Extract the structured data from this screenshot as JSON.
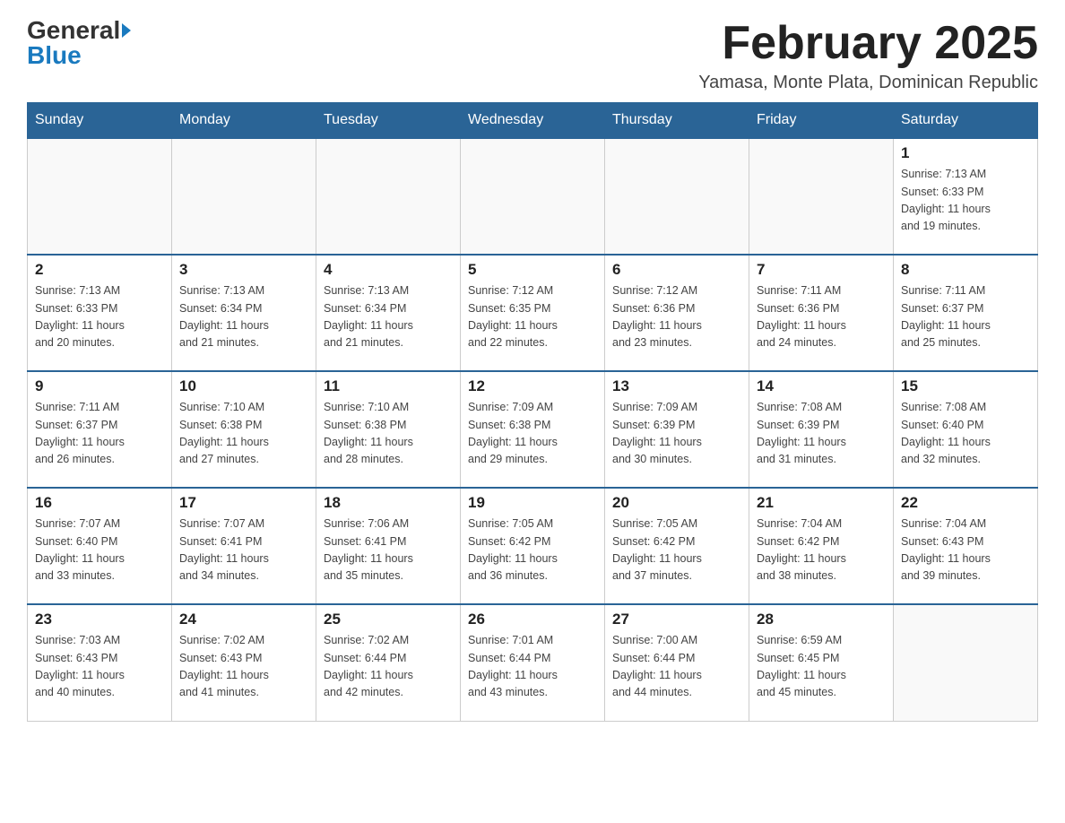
{
  "header": {
    "logo_main": "General",
    "logo_sub": "Blue",
    "month_year": "February 2025",
    "location": "Yamasa, Monte Plata, Dominican Republic"
  },
  "days_of_week": [
    "Sunday",
    "Monday",
    "Tuesday",
    "Wednesday",
    "Thursday",
    "Friday",
    "Saturday"
  ],
  "weeks": [
    [
      {
        "day": "",
        "info": ""
      },
      {
        "day": "",
        "info": ""
      },
      {
        "day": "",
        "info": ""
      },
      {
        "day": "",
        "info": ""
      },
      {
        "day": "",
        "info": ""
      },
      {
        "day": "",
        "info": ""
      },
      {
        "day": "1",
        "info": "Sunrise: 7:13 AM\nSunset: 6:33 PM\nDaylight: 11 hours\nand 19 minutes."
      }
    ],
    [
      {
        "day": "2",
        "info": "Sunrise: 7:13 AM\nSunset: 6:33 PM\nDaylight: 11 hours\nand 20 minutes."
      },
      {
        "day": "3",
        "info": "Sunrise: 7:13 AM\nSunset: 6:34 PM\nDaylight: 11 hours\nand 21 minutes."
      },
      {
        "day": "4",
        "info": "Sunrise: 7:13 AM\nSunset: 6:34 PM\nDaylight: 11 hours\nand 21 minutes."
      },
      {
        "day": "5",
        "info": "Sunrise: 7:12 AM\nSunset: 6:35 PM\nDaylight: 11 hours\nand 22 minutes."
      },
      {
        "day": "6",
        "info": "Sunrise: 7:12 AM\nSunset: 6:36 PM\nDaylight: 11 hours\nand 23 minutes."
      },
      {
        "day": "7",
        "info": "Sunrise: 7:11 AM\nSunset: 6:36 PM\nDaylight: 11 hours\nand 24 minutes."
      },
      {
        "day": "8",
        "info": "Sunrise: 7:11 AM\nSunset: 6:37 PM\nDaylight: 11 hours\nand 25 minutes."
      }
    ],
    [
      {
        "day": "9",
        "info": "Sunrise: 7:11 AM\nSunset: 6:37 PM\nDaylight: 11 hours\nand 26 minutes."
      },
      {
        "day": "10",
        "info": "Sunrise: 7:10 AM\nSunset: 6:38 PM\nDaylight: 11 hours\nand 27 minutes."
      },
      {
        "day": "11",
        "info": "Sunrise: 7:10 AM\nSunset: 6:38 PM\nDaylight: 11 hours\nand 28 minutes."
      },
      {
        "day": "12",
        "info": "Sunrise: 7:09 AM\nSunset: 6:38 PM\nDaylight: 11 hours\nand 29 minutes."
      },
      {
        "day": "13",
        "info": "Sunrise: 7:09 AM\nSunset: 6:39 PM\nDaylight: 11 hours\nand 30 minutes."
      },
      {
        "day": "14",
        "info": "Sunrise: 7:08 AM\nSunset: 6:39 PM\nDaylight: 11 hours\nand 31 minutes."
      },
      {
        "day": "15",
        "info": "Sunrise: 7:08 AM\nSunset: 6:40 PM\nDaylight: 11 hours\nand 32 minutes."
      }
    ],
    [
      {
        "day": "16",
        "info": "Sunrise: 7:07 AM\nSunset: 6:40 PM\nDaylight: 11 hours\nand 33 minutes."
      },
      {
        "day": "17",
        "info": "Sunrise: 7:07 AM\nSunset: 6:41 PM\nDaylight: 11 hours\nand 34 minutes."
      },
      {
        "day": "18",
        "info": "Sunrise: 7:06 AM\nSunset: 6:41 PM\nDaylight: 11 hours\nand 35 minutes."
      },
      {
        "day": "19",
        "info": "Sunrise: 7:05 AM\nSunset: 6:42 PM\nDaylight: 11 hours\nand 36 minutes."
      },
      {
        "day": "20",
        "info": "Sunrise: 7:05 AM\nSunset: 6:42 PM\nDaylight: 11 hours\nand 37 minutes."
      },
      {
        "day": "21",
        "info": "Sunrise: 7:04 AM\nSunset: 6:42 PM\nDaylight: 11 hours\nand 38 minutes."
      },
      {
        "day": "22",
        "info": "Sunrise: 7:04 AM\nSunset: 6:43 PM\nDaylight: 11 hours\nand 39 minutes."
      }
    ],
    [
      {
        "day": "23",
        "info": "Sunrise: 7:03 AM\nSunset: 6:43 PM\nDaylight: 11 hours\nand 40 minutes."
      },
      {
        "day": "24",
        "info": "Sunrise: 7:02 AM\nSunset: 6:43 PM\nDaylight: 11 hours\nand 41 minutes."
      },
      {
        "day": "25",
        "info": "Sunrise: 7:02 AM\nSunset: 6:44 PM\nDaylight: 11 hours\nand 42 minutes."
      },
      {
        "day": "26",
        "info": "Sunrise: 7:01 AM\nSunset: 6:44 PM\nDaylight: 11 hours\nand 43 minutes."
      },
      {
        "day": "27",
        "info": "Sunrise: 7:00 AM\nSunset: 6:44 PM\nDaylight: 11 hours\nand 44 minutes."
      },
      {
        "day": "28",
        "info": "Sunrise: 6:59 AM\nSunset: 6:45 PM\nDaylight: 11 hours\nand 45 minutes."
      },
      {
        "day": "",
        "info": ""
      }
    ]
  ]
}
